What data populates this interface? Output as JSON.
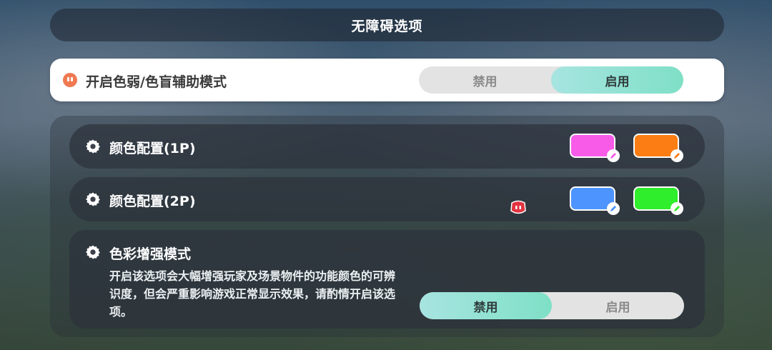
{
  "header": {
    "title": "无障碍选项"
  },
  "color_assist": {
    "label": "开启色弱/色盲辅助模式",
    "options": [
      "禁用",
      "启用"
    ],
    "selected": "启用"
  },
  "color_config_1p": {
    "label": "颜色配置(1P)",
    "swatches": [
      "#f75be8",
      "#fb7d13"
    ]
  },
  "color_config_2p": {
    "label": "颜色配置(2P)",
    "swatches": [
      "#4d94ff",
      "#2fee2b"
    ]
  },
  "color_enhance": {
    "title": "色彩增强模式",
    "description": "开启该选项会大幅增强玩家及场景物件的功能颜色的可辨识度，但会严重影响游戏正常显示效果，请酌情开启该选项。",
    "options": [
      "禁用",
      "启用"
    ],
    "selected": "禁用"
  },
  "colors": {
    "toggle_active": "#7fe0c6",
    "accent_icon": "#ef7a52"
  },
  "icons": [
    "gear-icon",
    "pencil-icon",
    "mascot-icon"
  ]
}
